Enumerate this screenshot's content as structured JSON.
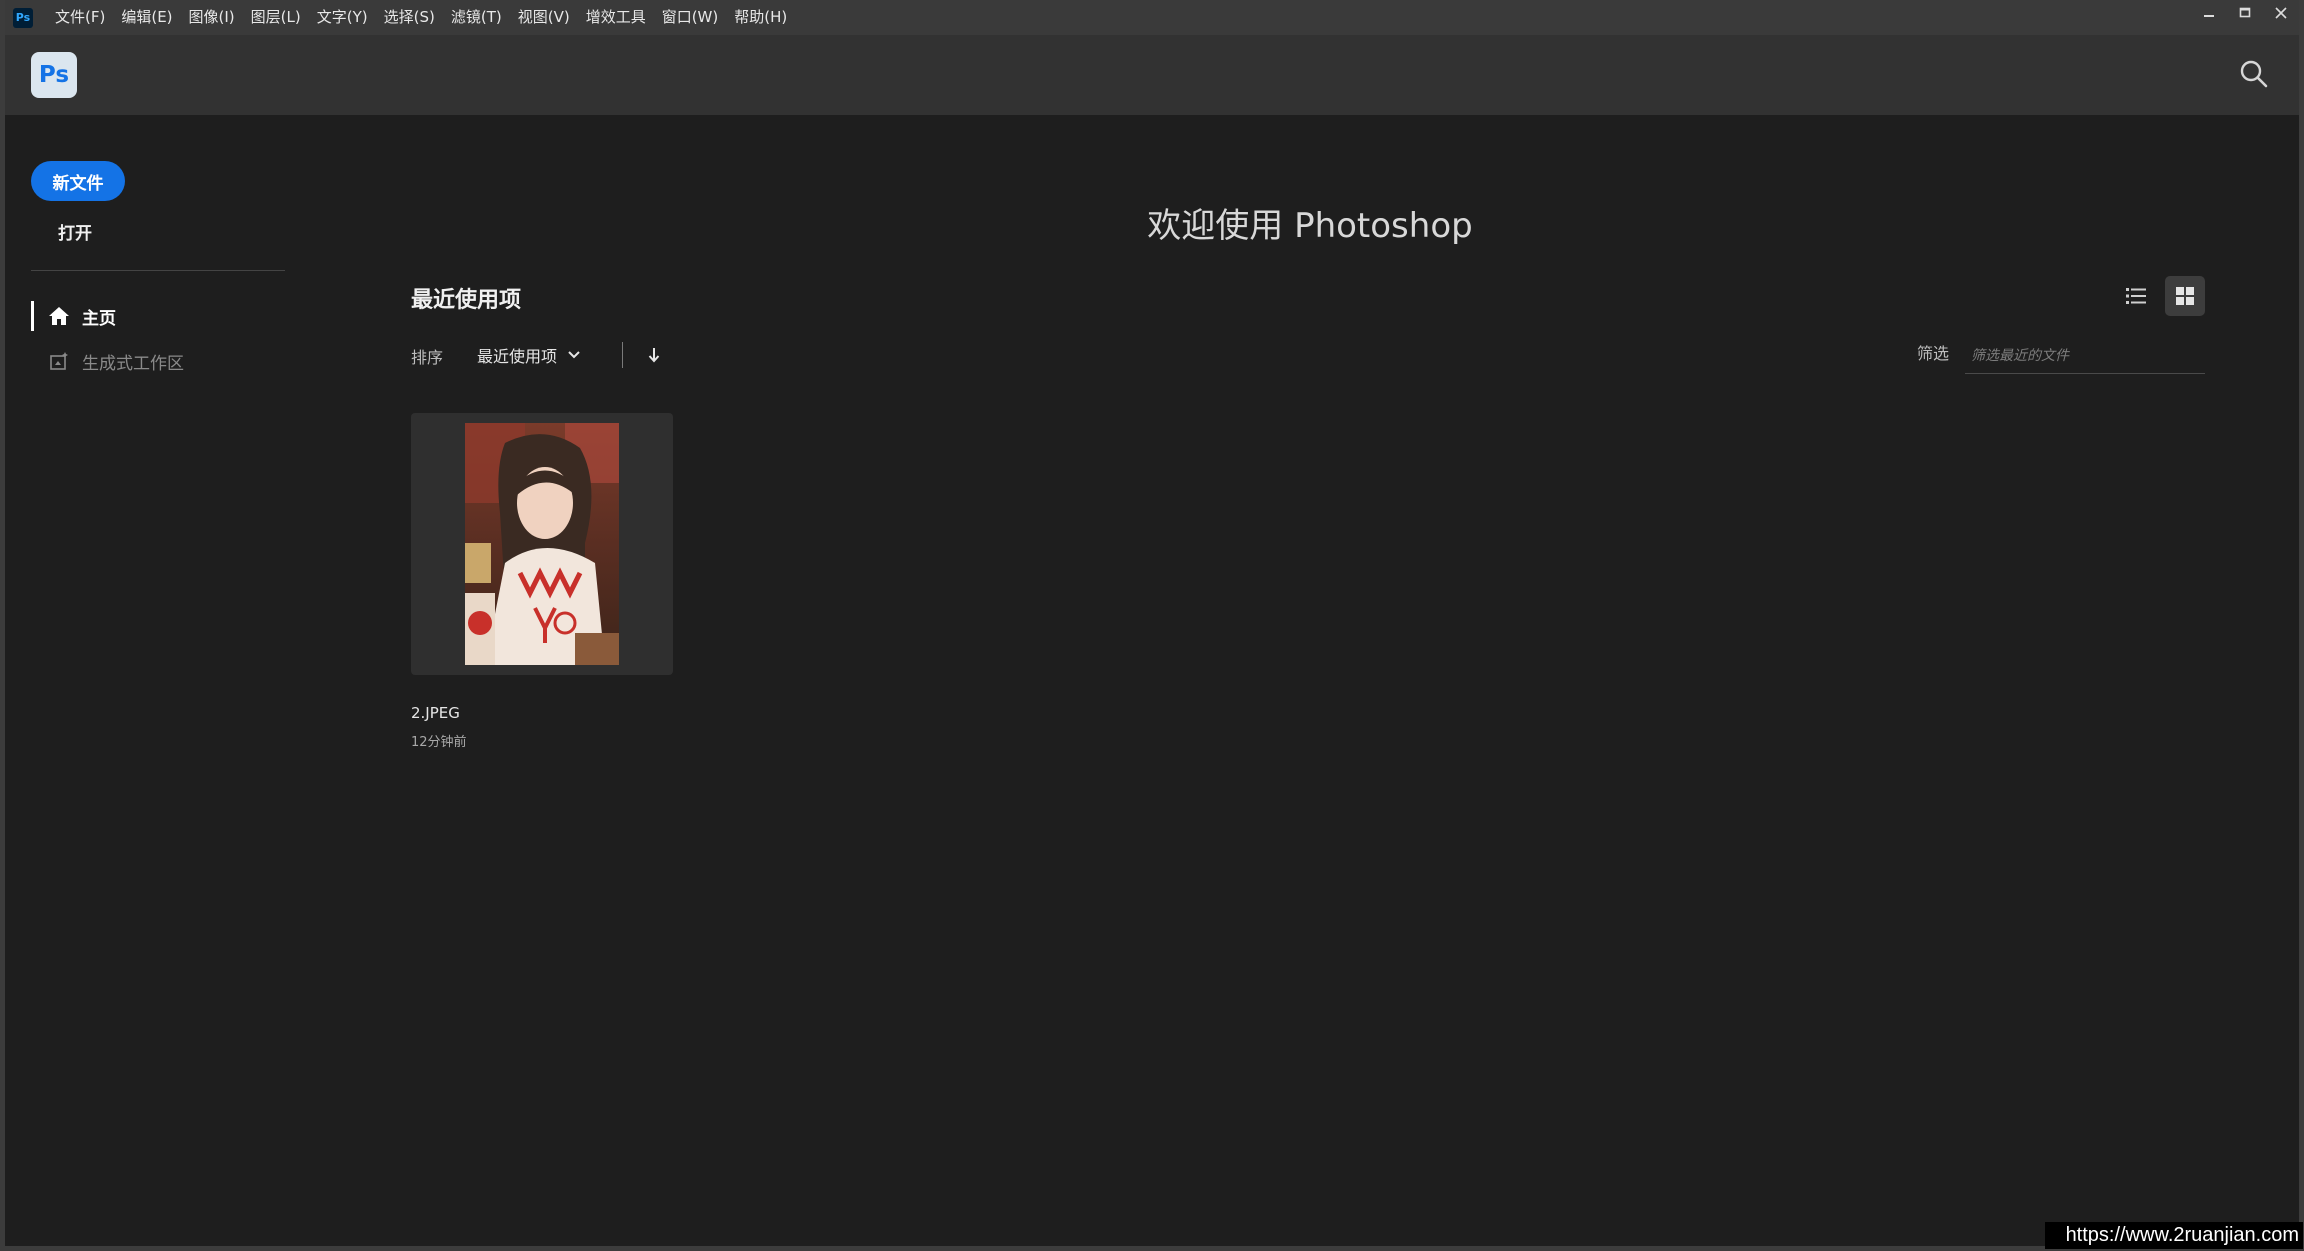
{
  "menubar": {
    "app_icon_text": "Ps",
    "items": [
      "文件(F)",
      "编辑(E)",
      "图像(I)",
      "图层(L)",
      "文字(Y)",
      "选择(S)",
      "滤镜(T)",
      "视图(V)",
      "增效工具",
      "窗口(W)",
      "帮助(H)"
    ],
    "window_controls": {
      "minimize": "—",
      "maximize": "□",
      "close": "✕"
    }
  },
  "appbar": {
    "logo_text": "Ps",
    "search_icon": "search-icon"
  },
  "sidebar": {
    "new_file_label": "新文件",
    "open_label": "打开",
    "nav": [
      {
        "label": "主页",
        "icon": "home-icon",
        "active": true
      },
      {
        "label": "生成式工作区",
        "icon": "generative-workspace-icon",
        "active": false
      }
    ]
  },
  "main": {
    "welcome": "欢迎使用 Photoshop",
    "recent_title": "最近使用项",
    "sort": {
      "label": "排序",
      "selected": "最近使用项",
      "direction_icon": "arrow-down-icon"
    },
    "view_toggle": {
      "list_icon": "list-view-icon",
      "grid_icon": "grid-view-icon",
      "selected": "grid"
    },
    "filter": {
      "label": "筛选",
      "placeholder": "筛选最近的文件",
      "value": ""
    },
    "files": [
      {
        "name": "2.JPEG",
        "time": "12分钟前",
        "thumbnail": "photo-thumbnail"
      }
    ]
  },
  "watermark": "https://www.2ruanjian.com",
  "colors": {
    "accent": "#1473e6",
    "background": "#1e1e1e",
    "header": "#323232",
    "menubar": "#3a3a3a"
  }
}
